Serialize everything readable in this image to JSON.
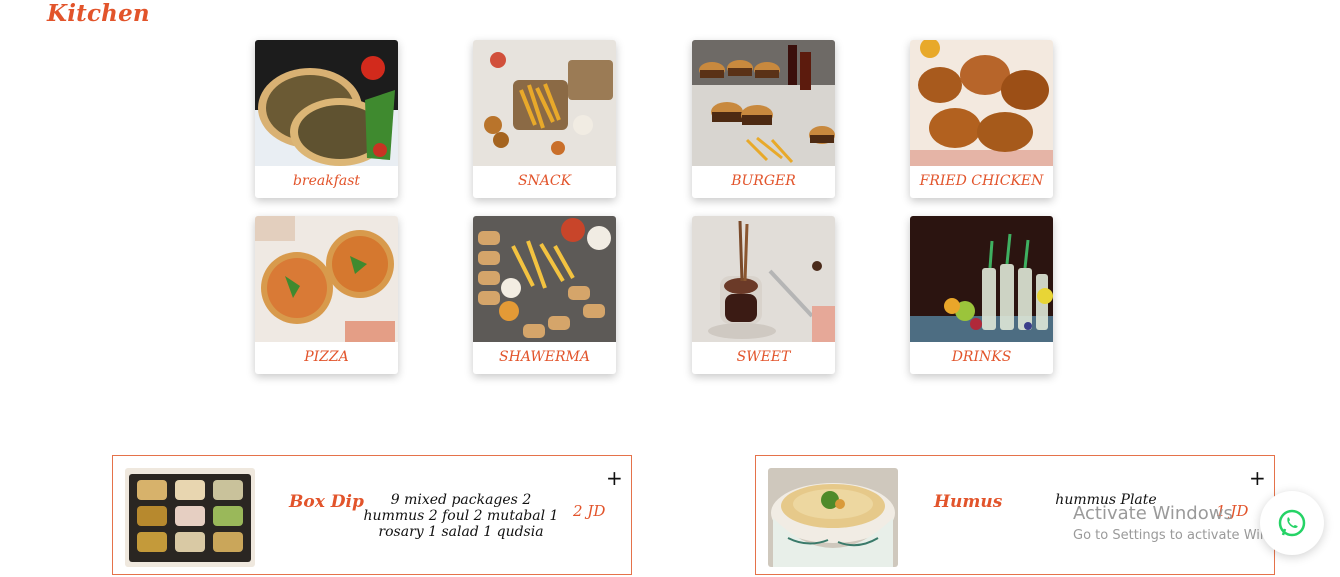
{
  "page": {
    "title": "Kitchen"
  },
  "categories": [
    {
      "label": "breakfast"
    },
    {
      "label": "SNACK"
    },
    {
      "label": "BURGER"
    },
    {
      "label": "FRIED CHICKEN"
    },
    {
      "label": "PIZZA"
    },
    {
      "label": "SHAWERMA"
    },
    {
      "label": "SWEET"
    },
    {
      "label": "DRINKS"
    }
  ],
  "items": [
    {
      "name": "Box Dip",
      "description_lines": [
        "9 mixed packages 2",
        "hummus 2 foul 2 mutabal 1",
        "rosary 1 salad 1 qudsia"
      ],
      "price": "2 JD",
      "add_label": "+"
    },
    {
      "name": "Humus",
      "description_lines": [
        "hummus Plate"
      ],
      "price": "1 JD",
      "add_label": "+"
    }
  ],
  "system_overlay": {
    "title": "Activate Windows",
    "subtitle": "Go to Settings to activate Windows."
  },
  "whatsapp": {
    "icon": "whatsapp-icon",
    "color": "#25d366"
  },
  "theme": {
    "accent": "#e2542b",
    "border": "#e5724a"
  }
}
